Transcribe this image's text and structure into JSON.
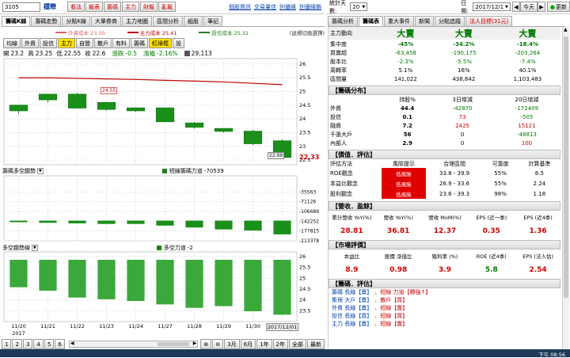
{
  "top": {
    "code": "3105",
    "name": "穩懋",
    "buttons": [
      "看法",
      "報表",
      "籌碼",
      "主力",
      "財報",
      "亂報"
    ],
    "links": [
      "個股資訊",
      "交易量佳",
      "別優緣",
      "別優緣鎖"
    ],
    "stat_label": "統計天數:",
    "stat_value": "20",
    "date_label": "日期:",
    "date_value": "2017/12/1",
    "today_label": "今天",
    "refresh_label": "更新"
  },
  "left_tabs": [
    "籌碼K線",
    "籌碼走勢",
    "分點K線",
    "大單券商",
    "主力地圖",
    "區間分析",
    "組股",
    "筆記"
  ],
  "ma_legend": [
    {
      "label": "外資成本 23.50",
      "color": "#e06060"
    },
    {
      "label": "主力成本 25.41",
      "color": "#c00000"
    },
    {
      "label": "投信成本 25.31",
      "color": "#208020"
    }
  ],
  "ma_note": "(鼠標切換選擇)",
  "indicator_buttons": [
    "均線",
    "外資",
    "投信",
    "主力",
    "自營",
    "散戶",
    "有料",
    "籌碼",
    "紅綠框",
    "設"
  ],
  "ohlc": {
    "open_label": "開",
    "open": "23.2",
    "high_label": "高",
    "high": "23.25",
    "low_label": "低",
    "low": "22.55",
    "close_label": "收",
    "close": "22.6",
    "change_label": "漲跌",
    "change": "-0.5",
    "pct_label": "漲幅",
    "pct": "-2.16%",
    "vol_icon": "vol",
    "vol": "29,113"
  },
  "main_ticks": [
    "26",
    "25.5",
    "25",
    "24.5",
    "24",
    "23.5",
    "23",
    "22.5",
    "22.33"
  ],
  "price_tag": "24.55",
  "low_tag": "22.88",
  "p2": {
    "title": "籌碼多空趨勢",
    "legend": "短線籌碼力道",
    "value": "-70539",
    "ticks": [
      "-35563",
      "-71126",
      "-106689",
      "-142252",
      "-177815",
      "-213378"
    ]
  },
  "p3": {
    "title": "多空趨勢線",
    "legend": "多空力道",
    "value": "-2",
    "ticks": [
      "26",
      "25.5",
      "25",
      "24.5",
      "24",
      "23.5"
    ]
  },
  "x_dates": [
    "11/20",
    "11/21",
    "11/22",
    "11/23",
    "11/24",
    "11/27",
    "11/28",
    "11/29",
    "11/30",
    "2017/12/01"
  ],
  "x_year": "2017",
  "bottom": {
    "pages": [
      "1",
      "2",
      "3",
      "4",
      "5",
      "6"
    ],
    "periods": [
      "3月",
      "6月",
      "1年",
      "2年",
      "全部",
      "最新"
    ],
    "zoom": [
      "放大",
      "縮小"
    ]
  },
  "chart_data": {
    "type": "bar",
    "panel": "main",
    "categories": [
      "11/20",
      "11/21",
      "11/22",
      "11/23",
      "11/24",
      "11/27",
      "11/28",
      "11/29",
      "11/30",
      "12/01"
    ],
    "candles": [
      {
        "open": 24.5,
        "close": 24.3,
        "high": 24.5,
        "low": 24.2
      },
      {
        "open": 24.9,
        "close": 24.7,
        "high": 24.9,
        "low": 24.6
      },
      {
        "open": 24.9,
        "close": 24.4,
        "high": 24.95,
        "low": 24.4
      },
      {
        "open": 24.6,
        "close": 24.35,
        "high": 24.6,
        "low": 24.3
      },
      {
        "open": 24.4,
        "close": 24.3,
        "high": 24.4,
        "low": 24.25
      },
      {
        "open": 24.4,
        "close": 23.9,
        "high": 24.4,
        "low": 23.9
      },
      {
        "open": 23.85,
        "close": 23.7,
        "high": 23.9,
        "low": 23.65
      },
      {
        "open": 23.65,
        "close": 23.55,
        "high": 23.65,
        "low": 23.5
      },
      {
        "open": 23.55,
        "close": 23.1,
        "high": 23.6,
        "low": 23.05
      },
      {
        "open": 23.2,
        "close": 22.6,
        "high": 23.25,
        "low": 22.55
      }
    ],
    "ma_red": [
      25.5,
      25.5,
      25.48,
      25.46,
      25.44,
      25.41,
      25.38,
      25.35,
      25.3,
      25.25
    ],
    "p2_values": [
      -142000,
      -148000,
      -150000,
      -152000,
      -152000,
      -158000,
      -165000,
      -172000,
      -176000,
      -190000
    ],
    "p2_ylim": [
      -213378,
      0
    ],
    "p3_values": [
      -1.6,
      -1.8,
      -2.2,
      -2.3,
      -2.4,
      -2.6,
      -2.8,
      -2.7,
      -3.0,
      -3.2
    ],
    "ylim": [
      22.33,
      26.2
    ]
  },
  "right_tabs": [
    "籌碼分析",
    "籌碼表",
    "重大事件",
    "新聞",
    "分點追蹤",
    "法人目標(31元)"
  ],
  "summary": {
    "label_col": "主力動向",
    "cols": [
      "大賣",
      "大賣",
      "大賣"
    ],
    "rows": [
      {
        "label": "集中度",
        "v": [
          "-45%",
          "-34.2%",
          "-18.4%"
        ]
      },
      {
        "label": "買賣超",
        "v": [
          "-63,458",
          "-190,175",
          "-203,264"
        ]
      },
      {
        "label": "股本比",
        "v": [
          "-2.3%",
          "-5.5%",
          "-7.4%"
        ]
      },
      {
        "label": "周轉率",
        "v": [
          "5.1%",
          "16%",
          "40.1%"
        ]
      },
      {
        "label": "區間量",
        "v": [
          "141,022",
          "438,842",
          "1,103,483"
        ]
      }
    ]
  },
  "chips": {
    "title": "【籌碼分布】",
    "headers": [
      "持股%",
      "3日增減",
      "20日增減"
    ],
    "rows": [
      {
        "label": "外資",
        "v": [
          "44.4",
          "-42870",
          "-172409"
        ]
      },
      {
        "label": "投信",
        "v": [
          "0.1",
          "73",
          "-505"
        ]
      },
      {
        "label": "融資",
        "v": [
          "7.2",
          "2425",
          "15121"
        ]
      },
      {
        "label": "千張大戶",
        "v": [
          "56",
          "0",
          "-48813"
        ]
      },
      {
        "label": "內部人",
        "v": [
          "2.9",
          "0",
          "100"
        ]
      }
    ]
  },
  "valuation": {
    "title": "【價值．評估】",
    "headers": [
      "評估方法",
      "風險提示",
      "合理區間",
      "可靠度",
      "計算基準"
    ],
    "rows": [
      {
        "label": "ROE觀念",
        "risk": "低風險",
        "range": "33.8 - 39.9",
        "rel": "55%",
        "base": "8.5"
      },
      {
        "label": "本益比觀念",
        "risk": "低風險",
        "range": "26.9 - 33.6",
        "rel": "55%",
        "base": "2.24"
      },
      {
        "label": "股利觀念",
        "risk": "低風險",
        "range": "23.6 - 39.3",
        "rel": "98%",
        "base": "1.18"
      }
    ]
  },
  "revenue": {
    "title": "【營收．盈餘】",
    "headers": [
      "累計營收 YoY(%)",
      "營收 YoY(%)",
      "營收 MoM(%)",
      "EPS (近一季)",
      "EPS (近4季)"
    ],
    "values": [
      "28.81",
      "36.81",
      "12.37",
      "0.35",
      "1.36"
    ]
  },
  "market": {
    "title": "【市場評價】",
    "headers": [
      "本益比",
      "股價 淨值比",
      "殖利率 (%)",
      "ROE (近4季)",
      "EPS (法人估)"
    ],
    "values": [
      "8.9",
      "0.98",
      "3.9",
      "5.8",
      "2.54"
    ]
  },
  "chip_eval": {
    "title": "【籌碼．評估】",
    "lines": [
      {
        "label": "籌碼 長線【賣】",
        "a": "短線 力道【轉強↑】"
      },
      {
        "label": "集保 大戶【賣】",
        "a": "散戶【買】"
      },
      {
        "label": "外資 長線【賣】",
        "a": "短線【賣】"
      },
      {
        "label": "投信 長線【買】",
        "a": "短線【買】"
      },
      {
        "label": "主力 長線【賣】",
        "a": "短線【賣】"
      }
    ]
  },
  "taskbar": {
    "time": "下午 08:56"
  }
}
